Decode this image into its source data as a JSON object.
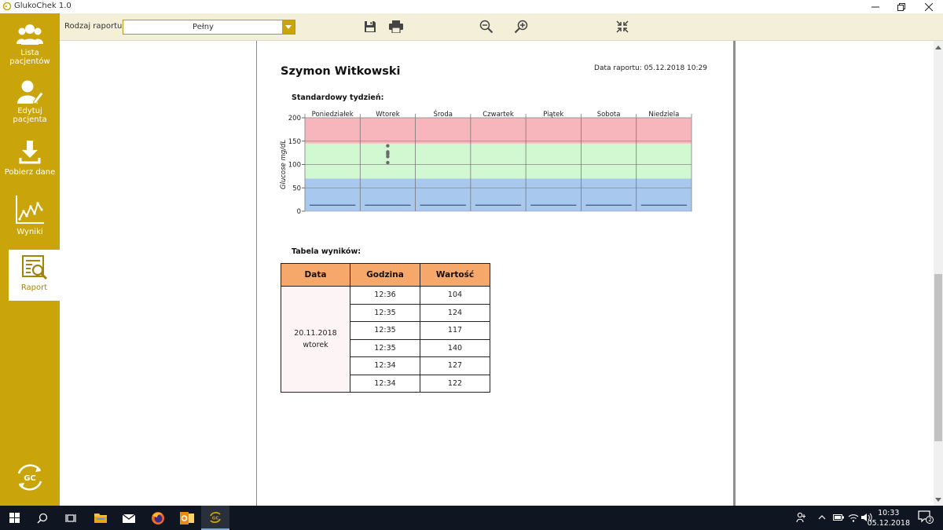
{
  "window": {
    "title": "GlukoChek 1.0",
    "controls": [
      "minimize-icon",
      "restore-icon",
      "close-icon"
    ]
  },
  "sidebar": {
    "items": [
      {
        "label_lines": [
          "Lista",
          "pacjentów"
        ],
        "icon": "users-icon"
      },
      {
        "label_lines": [
          "Edytuj",
          "pacjenta"
        ],
        "icon": "edit-user-icon"
      },
      {
        "label_lines": [
          "Pobierz dane"
        ],
        "icon": "download-icon"
      },
      {
        "label_lines": [
          "Wyniki"
        ],
        "icon": "line-chart-icon"
      },
      {
        "label_lines": [
          "Raport"
        ],
        "icon": "report-icon",
        "active": true
      }
    ],
    "logo_icon": "gc-logo-icon",
    "color": "#c9a40b"
  },
  "toolbar": {
    "report_type_label": "Rodzaj raportu:",
    "report_type_value": "Pełny",
    "buttons": [
      "save-icon",
      "print-icon",
      "zoom-out-icon",
      "zoom-in-icon",
      "fit-icon"
    ]
  },
  "report": {
    "patient_name": "Szymon Witkowski",
    "report_date": "Data raportu: 05.12.2018 10:29",
    "week_title": "Standardowy tydzień:",
    "table_title": "Tabela wyników:"
  },
  "chart_data": {
    "type": "scatter",
    "categories": [
      "Poniedziałek",
      "Wtorek",
      "Środa",
      "Czwartek",
      "Piątek",
      "Sobota",
      "Niedziela"
    ],
    "ylabel": "Glucose mg/dL",
    "ylim": [
      0,
      200
    ],
    "yticks": [
      "0",
      "50",
      "100",
      "150",
      "200"
    ],
    "bands": [
      {
        "from": 0,
        "to": 70,
        "color": "#a9c8ee"
      },
      {
        "from": 70,
        "to": 145,
        "color": "#d2f8d2"
      },
      {
        "from": 145,
        "to": 200,
        "color": "#f7b6bb"
      }
    ],
    "reference_lines": [
      50,
      100,
      150
    ],
    "series": [
      {
        "category": "Wtorek",
        "values": [
          104,
          124,
          117,
          140,
          127,
          122
        ]
      }
    ]
  },
  "results_table": {
    "headers": [
      "Data",
      "Godzina",
      "Wartość"
    ],
    "date_lines": [
      "20.11.2018",
      "wtorek"
    ],
    "rows": [
      {
        "time": "12:36",
        "value": "104"
      },
      {
        "time": "12:35",
        "value": "124"
      },
      {
        "time": "12:35",
        "value": "117"
      },
      {
        "time": "12:35",
        "value": "140"
      },
      {
        "time": "12:34",
        "value": "127"
      },
      {
        "time": "12:34",
        "value": "122"
      }
    ],
    "header_color": "#f5a86a"
  },
  "taskbar": {
    "apps": [
      "windows-start-icon",
      "search-icon",
      "task-view-icon",
      "file-explorer-icon",
      "mail-icon",
      "firefox-icon",
      "outlook-icon",
      "glukochek-app-icon"
    ],
    "tray": [
      "people-icon",
      "chevron-up-icon",
      "battery-icon",
      "wifi-icon",
      "volume-icon"
    ],
    "time": "10:33",
    "date": "05.12.2018",
    "notification_count": "2"
  }
}
